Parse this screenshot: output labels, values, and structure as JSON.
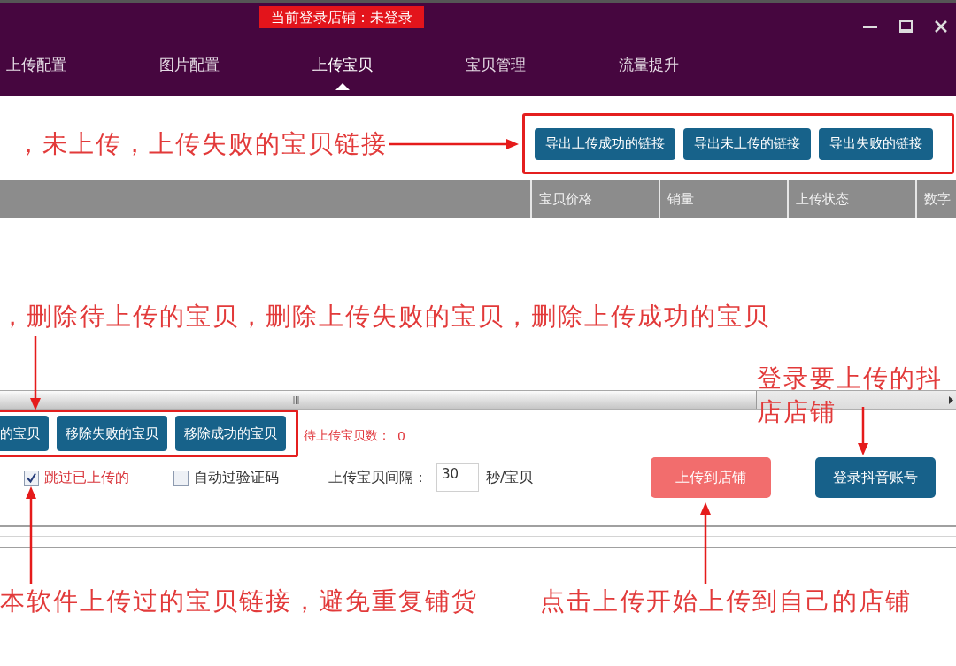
{
  "window": {
    "status_label": "当前登录店铺：未登录"
  },
  "tabs": [
    {
      "label": "上传配置",
      "selected": false
    },
    {
      "label": "图片配置",
      "selected": false
    },
    {
      "label": "上传宝贝",
      "selected": true
    },
    {
      "label": "宝贝管理",
      "selected": false
    },
    {
      "label": "流量提升",
      "selected": false
    }
  ],
  "export_bar": {
    "note": "，未上传，上传失败的宝贝链接",
    "buttons": [
      "导出上传成功的链接",
      "导出未上传的链接",
      "导出失败的链接"
    ]
  },
  "table": {
    "columns": [
      "宝贝价格",
      "销量",
      "上传状态",
      "数字"
    ],
    "note": "，删除待上传的宝贝，删除上传失败的宝贝，删除上传成功的宝贝"
  },
  "remove_bar": {
    "buttons": [
      "的宝贝",
      "移除失败的宝贝",
      "移除成功的宝贝"
    ],
    "pending_label": "待上传宝贝数：",
    "pending_count": "0"
  },
  "options": [
    {
      "label": "跳过已上传的",
      "checked": true,
      "color": "#d8343a"
    },
    {
      "label": "自动过验证码",
      "checked": false,
      "color": "#333333"
    }
  ],
  "interval": {
    "label": "上传宝贝间隔：",
    "value": "30",
    "unit": "秒/宝贝"
  },
  "actions": [
    {
      "label": "上传到店铺",
      "color": "#f26d6d"
    },
    {
      "label": "登录抖音账号",
      "color": "#17618a"
    }
  ],
  "notes": {
    "login": "登录要上传的抖店店铺",
    "skip": "本软件上传过的宝贝链接，避免重复铺货",
    "upload": "点击上传开始上传到自己的店铺"
  }
}
